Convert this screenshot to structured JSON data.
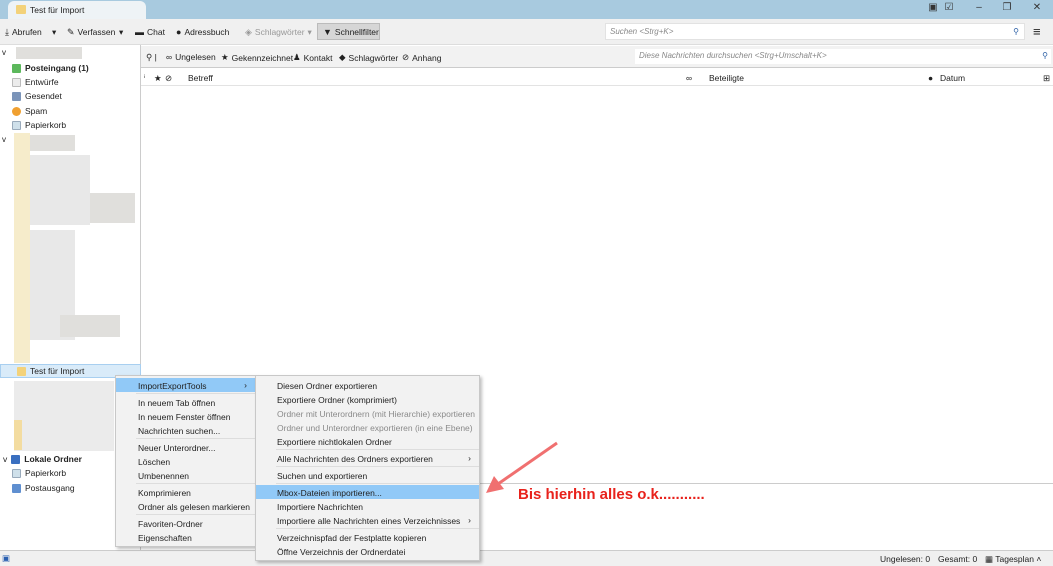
{
  "window": {
    "tab_title": "Test für Import"
  },
  "toolbar": {
    "abrufen": "Abrufen",
    "verfassen": "Verfassen",
    "chat": "Chat",
    "adressbuch": "Adressbuch",
    "schlagwoerter": "Schlagwörter",
    "schnellfilter": "Schnellfilter",
    "search_placeholder": "Suchen <Strg+K>"
  },
  "folders": {
    "account1": [
      "Posteingang (1)",
      "Entwürfe",
      "Gesendet",
      "Spam",
      "Papierkorb"
    ],
    "selected": "Test für Import",
    "local_title": "Lokale Ordner",
    "local": [
      "Papierkorb",
      "Postausgang"
    ]
  },
  "quickfilter": {
    "items": [
      "Ungelesen",
      "Gekennzeichnet",
      "Kontakt",
      "Schlagwörter",
      "Anhang"
    ],
    "search_placeholder": "Diese Nachrichten durchsuchen <Strg+Umschalt+K>"
  },
  "columns": {
    "subject": "Betreff",
    "participants": "Beteiligte",
    "date": "Datum"
  },
  "context_menu": {
    "items": [
      "ImportExportTools",
      "In neuem Tab öffnen",
      "In neuem Fenster öffnen",
      "Nachrichten suchen...",
      "Neuer Unterordner...",
      "Löschen",
      "Umbenennen",
      "Komprimieren",
      "Ordner als gelesen markieren",
      "Favoriten-Ordner",
      "Eigenschaften"
    ]
  },
  "submenu": {
    "items": [
      "Diesen Ordner exportieren",
      "Exportiere Ordner (komprimiert)",
      "Ordner mit Unterordnern (mit Hierarchie) exportieren",
      "Ordner und Unterordner exportieren (in eine Ebene)",
      "Exportiere nichtlokalen Ordner",
      "Alle Nachrichten des Ordners exportieren",
      "Suchen und exportieren",
      "Mbox-Dateien importieren...",
      "Importiere Nachrichten",
      "Importiere alle Nachrichten eines Verzeichnisses",
      "Verzeichnispfad der Festplatte kopieren",
      "Öffne Verzeichnis der Ordnerdatei"
    ]
  },
  "statusbar": {
    "unread": "Ungelesen: 0",
    "total": "Gesamt: 0",
    "today": "Tagesplan"
  },
  "annotation": {
    "text": "Bis hierhin alles o.k...........",
    "color": "#e8221c"
  }
}
